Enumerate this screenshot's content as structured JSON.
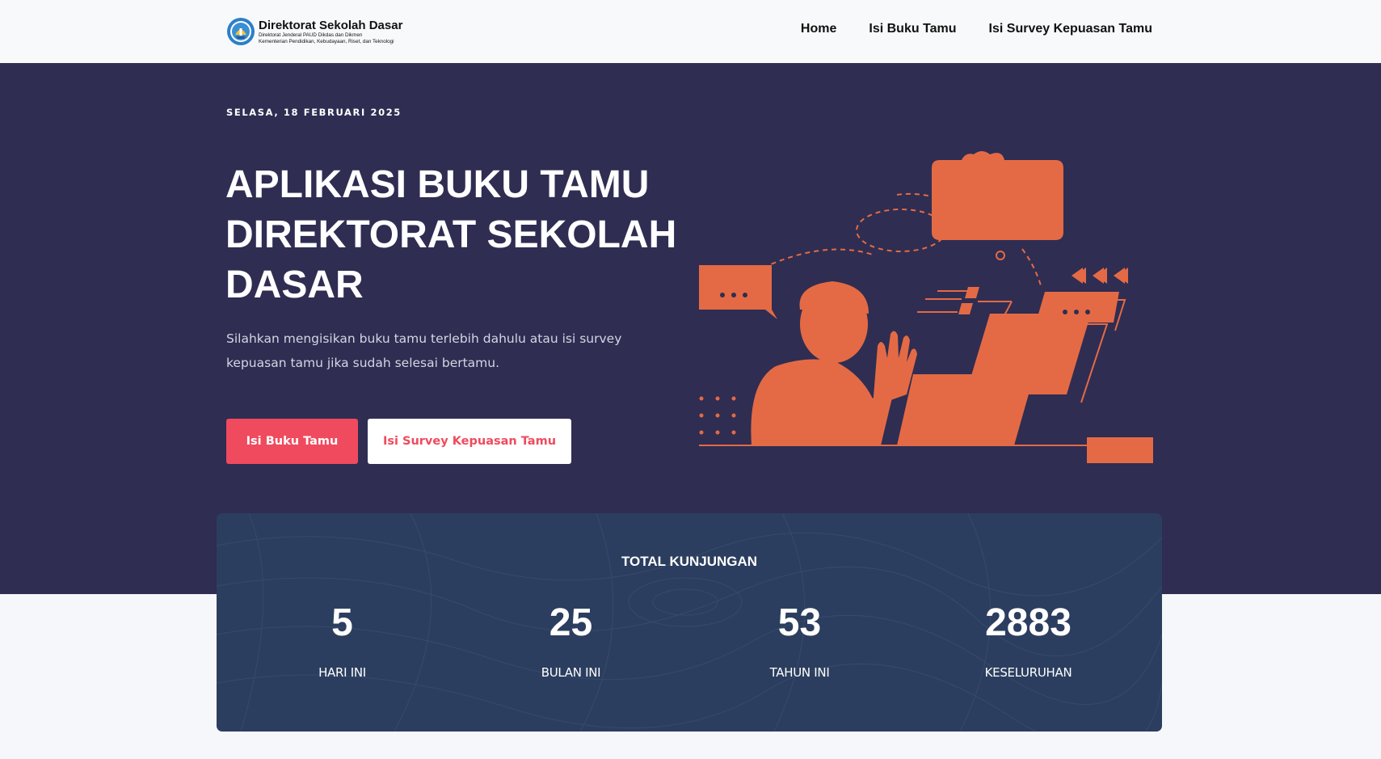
{
  "navbar": {
    "brand_title": "Direktorat Sekolah Dasar",
    "brand_sub_1": "Direktorat Jenderal PAUD Dikdas dan Dikmen",
    "brand_sub_2": "Kementerian Pendidikan, Kebudayaan, Riset, dan Teknologi",
    "links": [
      {
        "label": "Home"
      },
      {
        "label": "Isi Buku Tamu"
      },
      {
        "label": "Isi Survey Kepuasan Tamu"
      }
    ]
  },
  "hero": {
    "date": "SELASA, 18 FEBRUARI 2025",
    "title": "APLIKASI BUKU TAMU DIREKTORAT SEKOLAH DASAR",
    "description": "Silahkan mengisikan buku tamu terlebih dahulu atau isi survey kepuasan tamu jika sudah selesai bertamu.",
    "primary_button": "Isi Buku Tamu",
    "secondary_button": "Isi Survey Kepuasan Tamu"
  },
  "stats": {
    "heading": "TOTAL KUNJUNGAN",
    "items": [
      {
        "value": "5",
        "label": "HARI INI"
      },
      {
        "value": "25",
        "label": "BULAN INI"
      },
      {
        "value": "53",
        "label": "TAHUN INI"
      },
      {
        "value": "2883",
        "label": "KESELURUHAN"
      }
    ]
  },
  "colors": {
    "hero_bg": "#2f2d52",
    "accent": "#f04a5e",
    "illustration": "#e46a45",
    "stats_bg": "#2c3e5f"
  },
  "icons": {
    "logo": "tut-wuri-handayani-logo",
    "illustration": "person-waving-at-laptop-illustration"
  }
}
